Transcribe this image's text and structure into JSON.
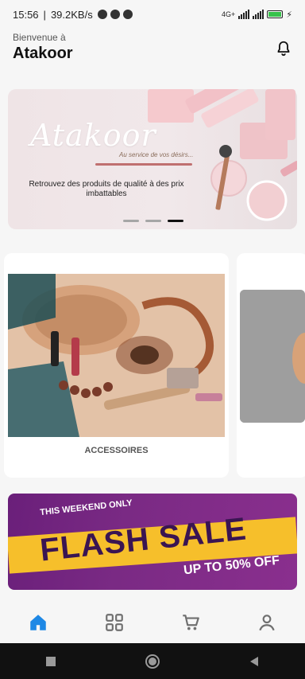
{
  "status": {
    "time": "15:56",
    "speed": "39.2KB/s",
    "network_label": "4G+",
    "battery_level": 0.85
  },
  "header": {
    "greeting": "Bienvenue à",
    "brand": "Atakoor"
  },
  "banner": {
    "logo_text": "Atakoor",
    "tagline": "Au service de vos désirs...",
    "text": "Retrouvez des produits de qualité à des prix imbattables",
    "active_dot": 3,
    "dot_count": 3
  },
  "categories": [
    {
      "label": "ACCESSOIRES"
    }
  ],
  "promo": {
    "top": "THIS WEEKEND ONLY",
    "main": "FLASH SALE",
    "sub": "UP TO 50% OFF"
  },
  "nav": {
    "items": [
      {
        "name": "home",
        "active": true
      },
      {
        "name": "categories",
        "active": false
      },
      {
        "name": "cart",
        "active": false
      },
      {
        "name": "profile",
        "active": false
      }
    ],
    "active_color": "#1e88e5",
    "inactive_color": "#6f6f6f"
  },
  "icons": {
    "bell": "bell-icon",
    "home": "home-icon",
    "grid": "grid-icon",
    "cart": "cart-icon",
    "user": "user-icon",
    "android_square": "square-icon",
    "android_circle": "circle-icon",
    "android_back": "back-icon"
  }
}
